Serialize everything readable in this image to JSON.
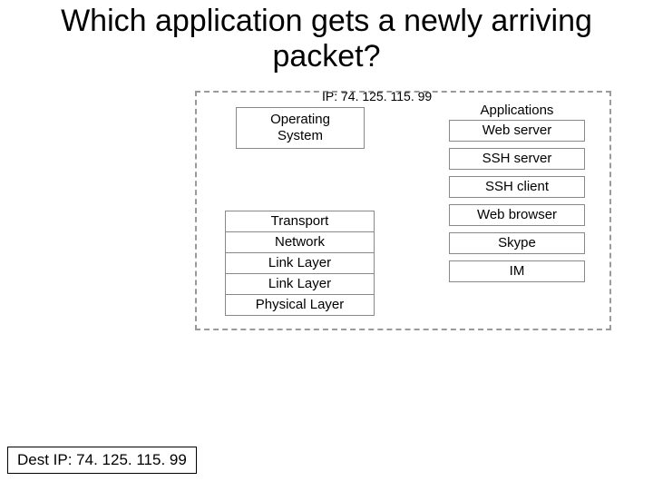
{
  "title": "Which application gets a newly arriving packet?",
  "ip_label": "IP: 74. 125. 115. 99",
  "os_box": "Operating\nSystem",
  "layers": [
    "Transport",
    "Network",
    "Link Layer",
    "Link Layer",
    "Physical Layer"
  ],
  "apps_heading": "Applications",
  "apps": [
    "Web server",
    "SSH server",
    "SSH client",
    "Web browser",
    "Skype",
    "IM"
  ],
  "dest": "Dest IP: 74. 125. 115. 99"
}
